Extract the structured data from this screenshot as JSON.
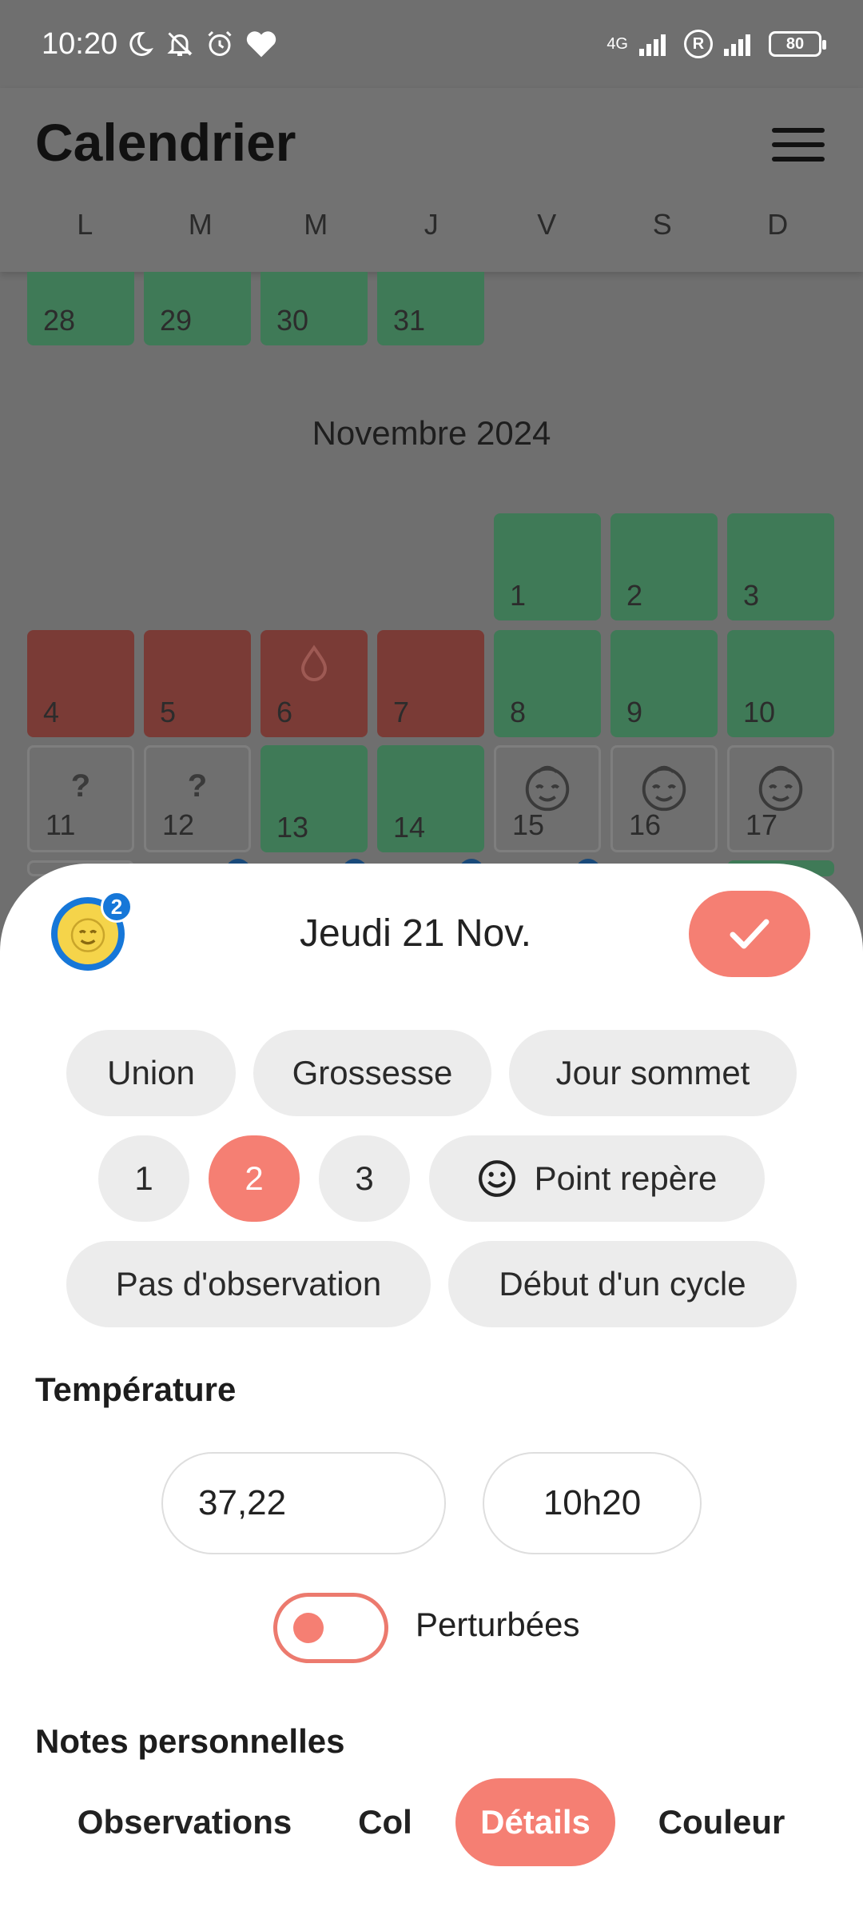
{
  "status_bar": {
    "time": "10:20",
    "network": "4G",
    "roaming": "R",
    "battery": "80"
  },
  "header": {
    "title": "Calendrier",
    "weekdays": [
      "L",
      "M",
      "M",
      "J",
      "V",
      "S",
      "D"
    ]
  },
  "calendar": {
    "october_tail": [
      "28",
      "29",
      "30",
      "31"
    ],
    "month_title": "Novembre 2024",
    "november_row1": [
      "1",
      "2",
      "3"
    ],
    "november_row2": [
      "4",
      "5",
      "6",
      "7",
      "8",
      "9",
      "10"
    ],
    "november_row3": [
      "11",
      "12",
      "13",
      "14",
      "15",
      "16",
      "17"
    ],
    "unknown_mark": "?"
  },
  "sheet": {
    "avatar_badge": "2",
    "date_title": "Jeudi 21 Nov.",
    "chips_row1": [
      "Union",
      "Grossesse",
      "Jour sommet"
    ],
    "chips_numbers": [
      "1",
      "2",
      "3"
    ],
    "selected_number": "2",
    "point_repere": "Point repère",
    "chips_row3": [
      "Pas d'observation",
      "Début d'un cycle"
    ],
    "temperature_label": "Température",
    "temperature_value": "37,22",
    "temperature_time": "10h20",
    "perturbed_label": "Perturbées",
    "notes_label": "Notes personnelles",
    "tabs": [
      "Observations",
      "Col",
      "Détails",
      "Couleur"
    ],
    "active_tab": "Détails"
  },
  "colors": {
    "accent": "#f57f73",
    "avatar_ring": "#1677d8",
    "fertile_green": "#3f7a57",
    "period_red": "#7a3b36"
  }
}
